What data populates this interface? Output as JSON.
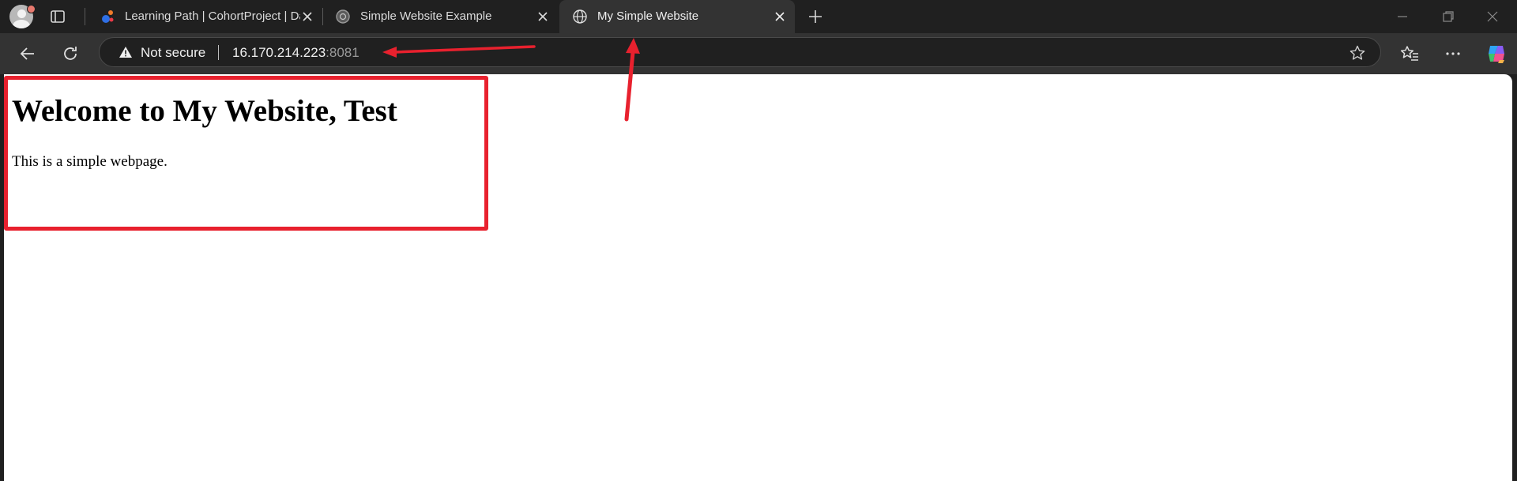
{
  "tabs": [
    {
      "title": "Learning Path | CohortProject | Da",
      "favicon": "project-favicon-icon",
      "active": false
    },
    {
      "title": "Simple Website Example",
      "favicon": "globe-favicon-icon",
      "active": false
    },
    {
      "title": "My Simple Website",
      "favicon": "globe-favicon-icon",
      "active": true
    }
  ],
  "address_bar": {
    "security_label": "Not secure",
    "security_icon": "warning-icon",
    "host": "16.170.214.223",
    "port": ":8081"
  },
  "page": {
    "heading": "Welcome to My Website, Test",
    "paragraph": "This is a simple webpage."
  },
  "annotations": {
    "color": "#e8212e",
    "items": [
      "highlight-box",
      "arrow-to-url",
      "arrow-to-tab"
    ]
  },
  "toolbar_icons": [
    "back-arrow-icon",
    "refresh-icon",
    "star-icon",
    "favorites-icon",
    "more-options-icon",
    "copilot-icon"
  ],
  "window_icons": [
    "minimize-icon",
    "restore-icon",
    "close-window-icon"
  ]
}
